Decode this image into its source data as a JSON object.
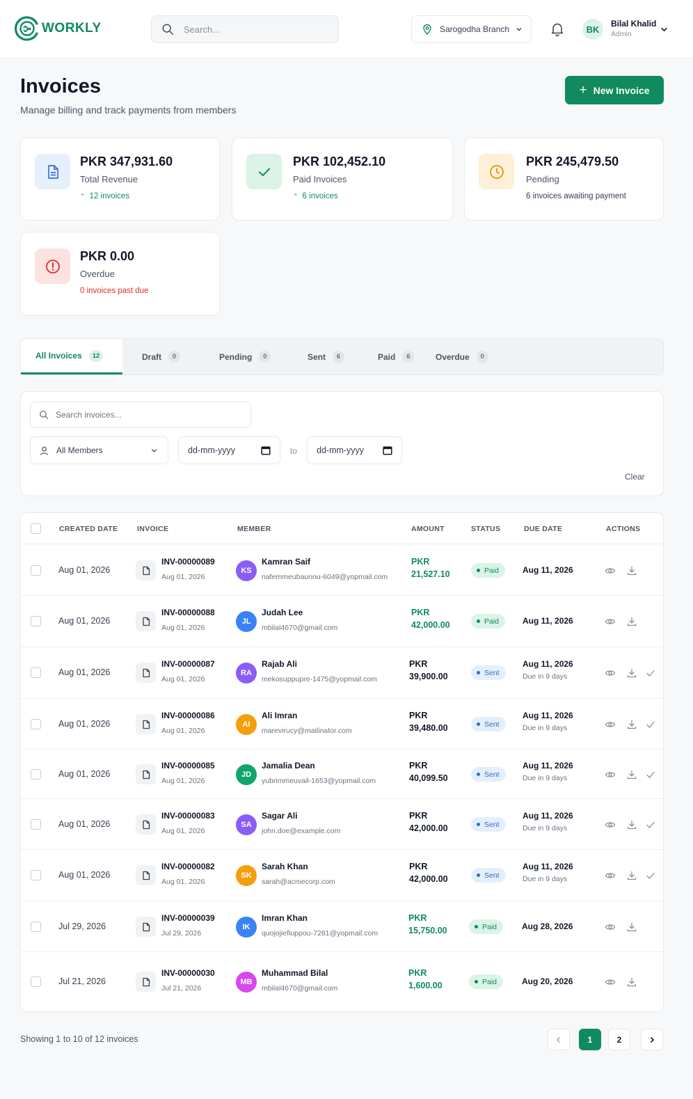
{
  "brand": {
    "name": "WORKLY",
    "color": "#108a5e"
  },
  "header": {
    "search_placeholder": "Search...",
    "branch": "Sarogodha Branch",
    "user_initials": "BK",
    "user_name": "Bilal Khalid",
    "user_role": "Admin"
  },
  "page": {
    "title": "Invoices",
    "subtitle": "Manage billing and track payments from members",
    "new_button": "New Invoice"
  },
  "stats": [
    {
      "amount": "PKR 347,931.60",
      "label": "Total Revenue",
      "meta": "12 invoices",
      "icon": "document-icon"
    },
    {
      "amount": "PKR 102,452.10",
      "label": "Paid Invoices",
      "meta": "6 invoices",
      "icon": "check-icon"
    },
    {
      "amount": "PKR 245,479.50",
      "label": "Pending",
      "meta": "6 invoices awaiting payment",
      "icon": "clock-icon"
    },
    {
      "amount": "PKR 0.00",
      "label": "Overdue",
      "meta": "0 invoices past due",
      "icon": "alert-icon"
    }
  ],
  "tabs": [
    {
      "label": "All Invoices",
      "count": "12"
    },
    {
      "label": "Draft",
      "count": "0"
    },
    {
      "label": "Pending",
      "count": "0"
    },
    {
      "label": "Sent",
      "count": "6"
    },
    {
      "label": "Paid",
      "count": "6"
    },
    {
      "label": "Overdue",
      "count": "0"
    }
  ],
  "filters": {
    "search_placeholder": "Search invoices...",
    "member_select": "All Members",
    "date_from": "dd-mm-yyyy",
    "date_to": "dd-mm-yyyy",
    "to_label": "to",
    "clear_label": "Clear"
  },
  "table": {
    "columns": [
      "CREATED DATE",
      "INVOICE",
      "MEMBER",
      "AMOUNT",
      "STATUS",
      "DUE DATE",
      "ACTIONS"
    ],
    "rows": [
      {
        "created": "Aug 01, 2026",
        "invoice": "INV-00000089",
        "invoice_date": "Aug 01, 2026",
        "initials": "KS",
        "avatar_color": "#8b5cf6",
        "name": "Kamran Saif",
        "email": "nafemmeubaunnu-6049@yopmail.com",
        "currency": "PKR",
        "amount": "21,527.10",
        "status": "Paid",
        "due": "Aug 11, 2026",
        "due_note": ""
      },
      {
        "created": "Aug 01, 2026",
        "invoice": "INV-00000088",
        "invoice_date": "Aug 01, 2026",
        "initials": "JL",
        "avatar_color": "#3b82f6",
        "name": "Judah Lee",
        "email": "mbilal4670@gmail.com",
        "currency": "PKR",
        "amount": "42,000.00",
        "status": "Paid",
        "due": "Aug 11, 2026",
        "due_note": ""
      },
      {
        "created": "Aug 01, 2026",
        "invoice": "INV-00000087",
        "invoice_date": "Aug 01, 2026",
        "initials": "RA",
        "avatar_color": "#8b5cf6",
        "name": "Rajab Ali",
        "email": "mekosuppupre-1475@yopmail.com",
        "currency": "PKR",
        "amount": "39,900.00",
        "status": "Sent",
        "due": "Aug 11, 2026",
        "due_note": "Due in 9 days"
      },
      {
        "created": "Aug 01, 2026",
        "invoice": "INV-00000086",
        "invoice_date": "Aug 01, 2026",
        "initials": "AI",
        "avatar_color": "#f59e0b",
        "name": "Ali Imran",
        "email": "marevirucy@mailinator.com",
        "currency": "PKR",
        "amount": "39,480.00",
        "status": "Sent",
        "due": "Aug 11, 2026",
        "due_note": "Due in 9 days"
      },
      {
        "created": "Aug 01, 2026",
        "invoice": "INV-00000085",
        "invoice_date": "Aug 01, 2026",
        "initials": "JD",
        "avatar_color": "#10a66a",
        "name": "Jamalia Dean",
        "email": "yubrimmeuvail-1653@yopmail.com",
        "currency": "PKR",
        "amount": "40,099.50",
        "status": "Sent",
        "due": "Aug 11, 2026",
        "due_note": "Due in 9 days"
      },
      {
        "created": "Aug 01, 2026",
        "invoice": "INV-00000083",
        "invoice_date": "Aug 01, 2026",
        "initials": "SA",
        "avatar_color": "#8b5cf6",
        "name": "Sagar Ali",
        "email": "john.doe@example.com",
        "currency": "PKR",
        "amount": "42,000.00",
        "status": "Sent",
        "due": "Aug 11, 2026",
        "due_note": "Due in 9 days"
      },
      {
        "created": "Aug 01, 2026",
        "invoice": "INV-00000082",
        "invoice_date": "Aug 01, 2026",
        "initials": "SK",
        "avatar_color": "#f59e0b",
        "name": "Sarah Khan",
        "email": "sarah@acmecorp.com",
        "currency": "PKR",
        "amount": "42,000.00",
        "status": "Sent",
        "due": "Aug 11, 2026",
        "due_note": "Due in 9 days"
      },
      {
        "created": "Jul 29, 2026",
        "invoice": "INV-00000039",
        "invoice_date": "Jul 29, 2026",
        "initials": "IK",
        "avatar_color": "#3b82f6",
        "name": "Imran Khan",
        "email": "quojojiefiuppou-7281@yopmail.com",
        "currency": "PKR",
        "amount": "15,750.00",
        "status": "Paid",
        "due": "Aug 28, 2026",
        "due_note": ""
      },
      {
        "created": "Jul 21, 2026",
        "invoice": "INV-00000030",
        "invoice_date": "Jul 21, 2026",
        "initials": "MB",
        "avatar_color": "#d946ef",
        "name": "Muhammad Bilal",
        "email": "mbilal4670@gmail.com",
        "currency": "PKR",
        "amount": "1,600.00",
        "status": "Paid",
        "due": "Aug 20, 2026",
        "due_note": ""
      }
    ]
  },
  "pagination": {
    "summary": "Showing 1 to 10 of 12 invoices",
    "pages": [
      "1",
      "2"
    ],
    "current": "1"
  }
}
